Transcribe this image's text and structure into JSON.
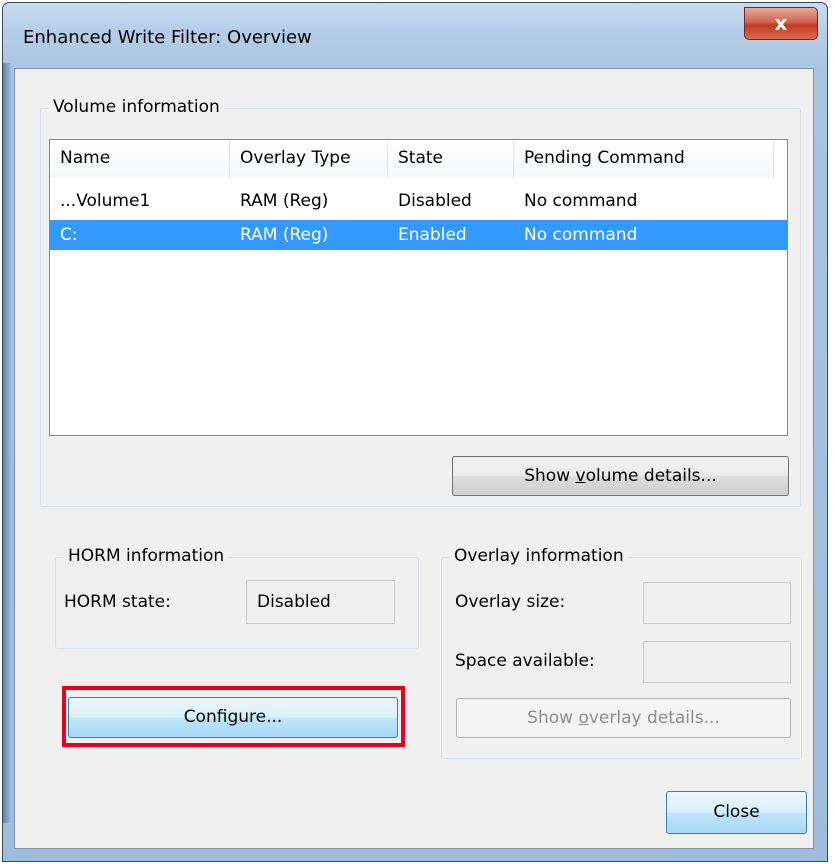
{
  "window": {
    "title": "Enhanced Write Filter: Overview",
    "close_glyph": "x"
  },
  "volume_group": {
    "label": "Volume information",
    "columns": [
      "Name",
      "Overlay Type",
      "State",
      "Pending Command"
    ],
    "rows": [
      {
        "name": "...Volume1",
        "overlay_type": "RAM (Reg)",
        "state": "Disabled",
        "pending": "No command",
        "selected": false
      },
      {
        "name": "C:",
        "overlay_type": "RAM (Reg)",
        "state": "Enabled",
        "pending": "No command",
        "selected": true
      }
    ],
    "details_button": {
      "pre": "Show ",
      "mnemonic": "v",
      "post": "olume details..."
    }
  },
  "horm_group": {
    "label": "HORM information",
    "state_label": "HORM state:",
    "state_value": "Disabled"
  },
  "overlay_group": {
    "label": "Overlay information",
    "size_label": "Overlay size:",
    "size_value": "",
    "space_label": "Space available:",
    "space_value": "",
    "details_button": {
      "pre": "Show ",
      "mnemonic": "o",
      "post": "verlay details..."
    }
  },
  "configure_button": {
    "pre": "Confi",
    "mnemonic": "g",
    "post": "ure..."
  },
  "close_button": {
    "label": "Close"
  },
  "colors": {
    "selection": "#3399ff",
    "highlight_box": "#e8001c",
    "dialog_bg": "#f0f0f0"
  }
}
